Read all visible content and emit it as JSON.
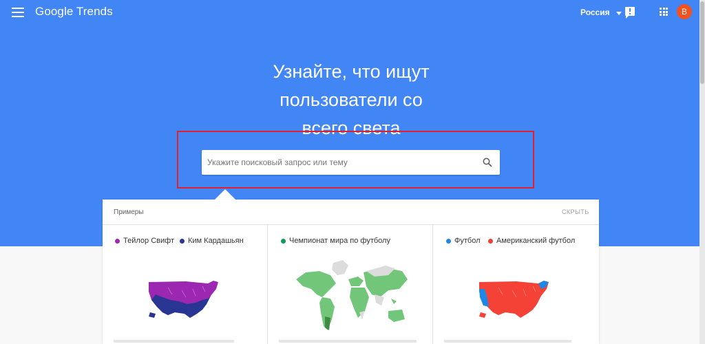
{
  "header": {
    "logo": "Google Trends",
    "region": "Россия",
    "avatar_letter": "B"
  },
  "hero": {
    "headline_lines": [
      "Узнайте, что ищут",
      "пользователи со",
      "всего света"
    ]
  },
  "search": {
    "placeholder": "Укажите поисковый запрос или тему"
  },
  "examples": {
    "title": "Примеры",
    "hide_label": "СКРЫТЬ",
    "cards": [
      {
        "legend": [
          {
            "label": "Тейлор Свифт",
            "color": "#9c27b0"
          },
          {
            "label": "Ким Кардашьян",
            "color": "#283593"
          }
        ],
        "map": "usa-map"
      },
      {
        "legend": [
          {
            "label": "Чемпионат мира по футболу",
            "color": "#0f9d58"
          }
        ],
        "map": "world-map"
      },
      {
        "legend": [
          {
            "label": "Футбол",
            "color": "#1e88e5"
          },
          {
            "label": "Американский футбол",
            "color": "#ea4335"
          }
        ],
        "map": "usa-map"
      }
    ]
  }
}
